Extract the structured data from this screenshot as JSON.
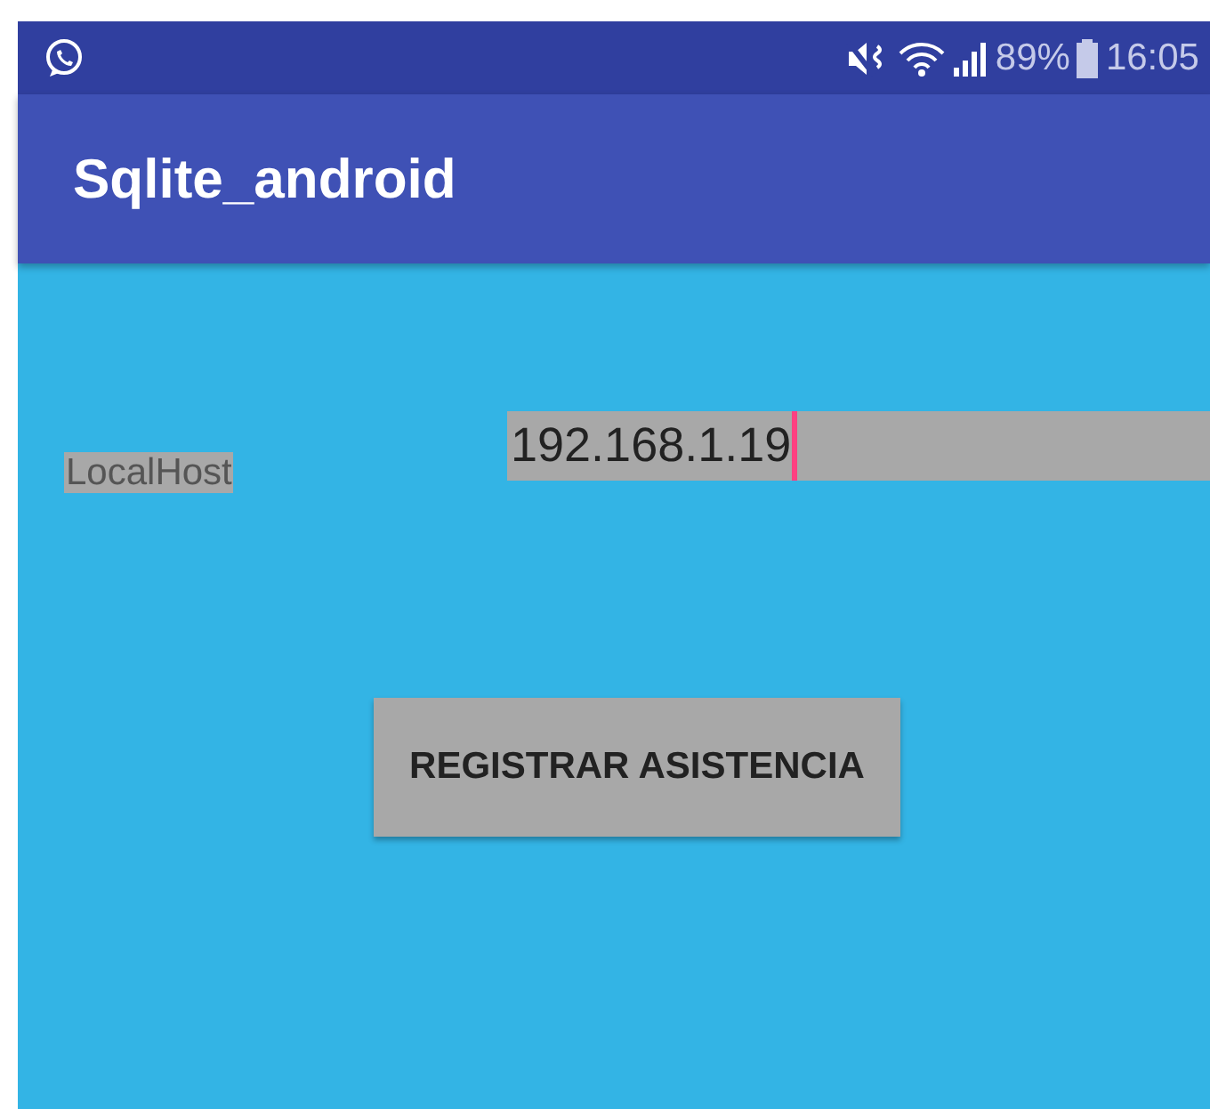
{
  "status_bar": {
    "battery_percent": "89%",
    "time": "16:05"
  },
  "app_bar": {
    "title": "Sqlite_android"
  },
  "form": {
    "label": "LocalHost",
    "field_value": "192.168.1.19",
    "focused": true
  },
  "buttons": [
    "REGISTRAR ASISTENCIA"
  ]
}
